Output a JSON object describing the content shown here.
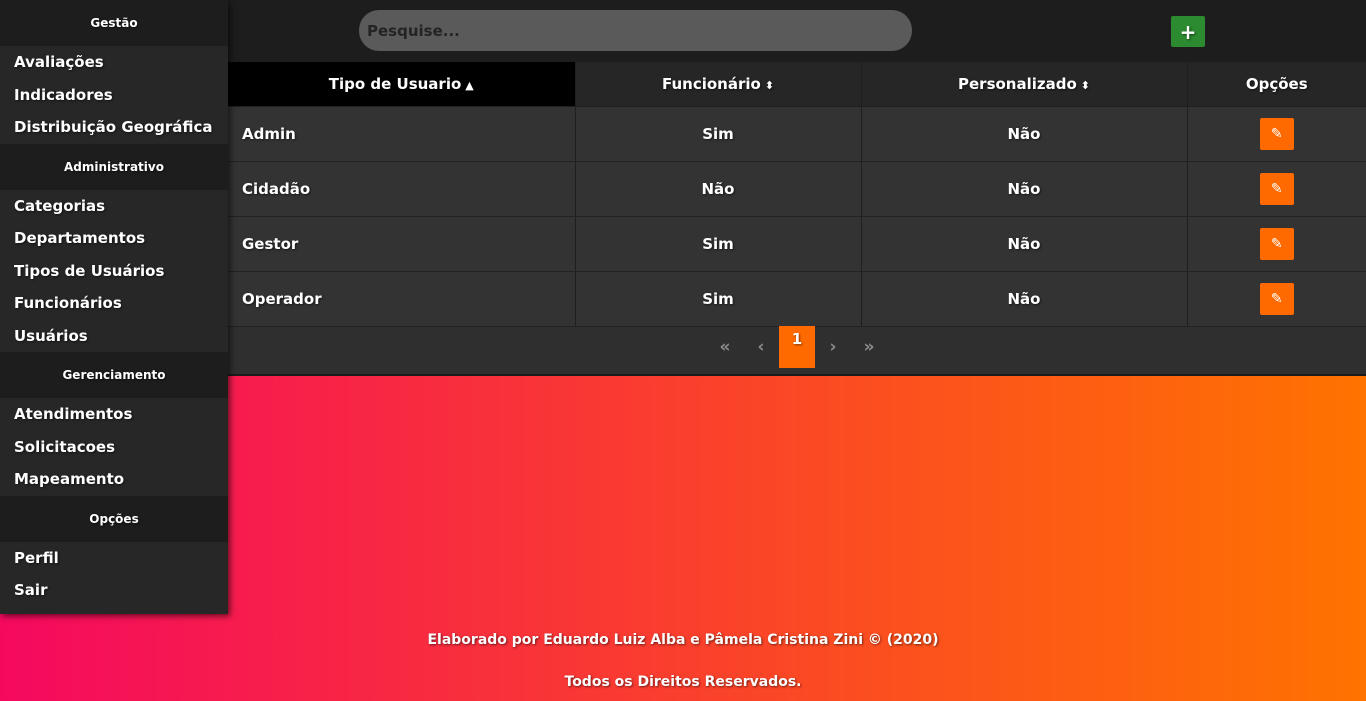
{
  "sidebar": {
    "groups": [
      {
        "title": "Gestão",
        "items": [
          "Avaliações",
          "Indicadores",
          "Distribuição Geográfica"
        ]
      },
      {
        "title": "Administrativo",
        "items": [
          "Categorias",
          "Departamentos",
          "Tipos de Usuários",
          "Funcionários",
          "Usuários"
        ]
      },
      {
        "title": "Gerenciamento",
        "items": [
          "Atendimentos",
          "Solicitacoes",
          "Mapeamento"
        ]
      },
      {
        "title": "Opções",
        "items": [
          "Perfil",
          "Sair"
        ]
      }
    ]
  },
  "topbar": {
    "search_placeholder": "Pesquise...",
    "add_label": "+"
  },
  "table": {
    "headers": [
      "Tipo de Usuario",
      "Funcionário",
      "Personalizado",
      "Opções"
    ],
    "sort_icons": [
      "▲",
      "⬍",
      "⬍",
      ""
    ],
    "rows": [
      [
        "Admin",
        "Sim",
        "Não"
      ],
      [
        "Cidadão",
        "Não",
        "Não"
      ],
      [
        "Gestor",
        "Sim",
        "Não"
      ],
      [
        "Operador",
        "Sim",
        "Não"
      ]
    ],
    "edit_icon": "pencil-icon",
    "edit_glyph": "✎"
  },
  "pagination": {
    "first": "«",
    "prev": "‹",
    "current": "1",
    "next": "›",
    "last": "»"
  },
  "footer": {
    "credit": "Elaborado por Eduardo Luiz Alba e Pâmela Cristina Zini © (2020)",
    "rights": "Todos os Direitos Reservados."
  },
  "colors": {
    "accent": "#ff6a00",
    "add_button": "#2c8a31",
    "gradient_start": "#f5095f",
    "gradient_end": "#ff7300"
  }
}
